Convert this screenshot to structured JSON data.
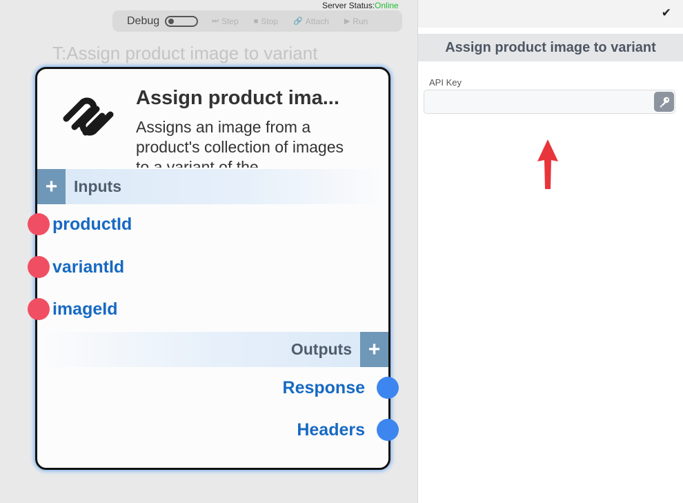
{
  "server": {
    "label": "Server Status:",
    "status": "Online"
  },
  "toolbar": {
    "debug_label": "Debug",
    "step": "Step",
    "stop": "Stop",
    "attach": "Attach",
    "run": "Run"
  },
  "node": {
    "canvas_title": "T:Assign product image to variant",
    "name": "Assign product ima...",
    "description": "Assigns an image from a product's collection of images to a variant of the",
    "inputs_label": "Inputs",
    "outputs_label": "Outputs",
    "inputs": [
      "productId",
      "variantId",
      "imageId"
    ],
    "outputs": [
      "Response",
      "Headers"
    ]
  },
  "panel": {
    "title": "Assign product image to variant",
    "api_key_label": "API Key",
    "api_key_value": ""
  },
  "icons": {
    "logo": "squarespace-logo-icon",
    "check": "check-icon",
    "key": "key-icon",
    "arrow": "red-up-arrow-icon"
  },
  "colors": {
    "input_port": "#f04f63",
    "output_port": "#3d86f0",
    "port_label": "#1769c2",
    "online": "#22bb33",
    "arrow": "#e8353b"
  }
}
